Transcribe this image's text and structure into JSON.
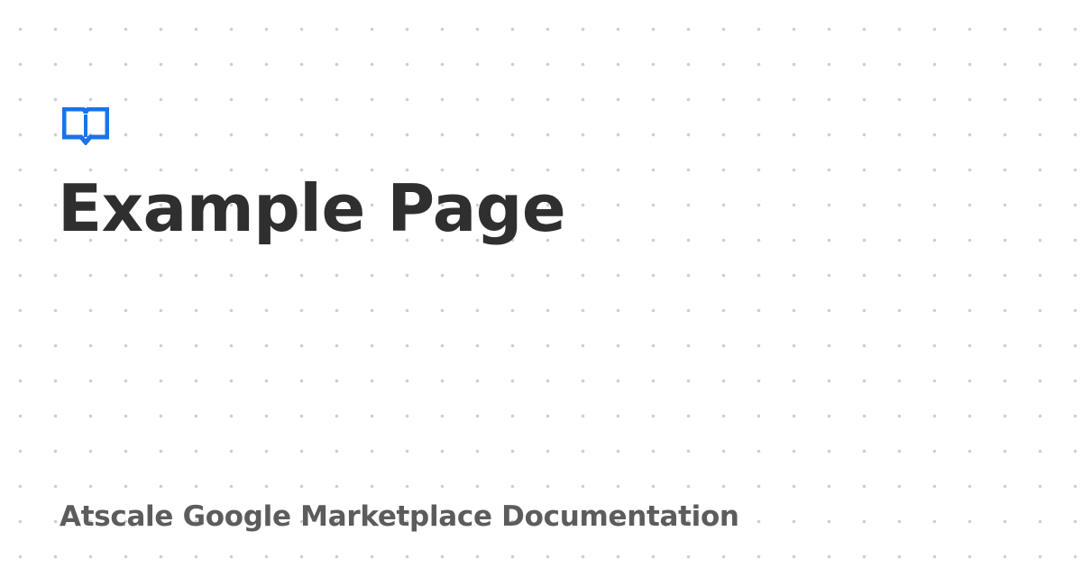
{
  "logo": {
    "icon": "open-book-icon",
    "color": "#1a73e8"
  },
  "page": {
    "title": "Example Page",
    "site_name": "Atscale Google Marketplace Documentation"
  },
  "colors": {
    "background": "#ffffff",
    "dots": "#cfcfcf",
    "title": "#2f2f2f",
    "subtitle": "#5c5c5c"
  }
}
